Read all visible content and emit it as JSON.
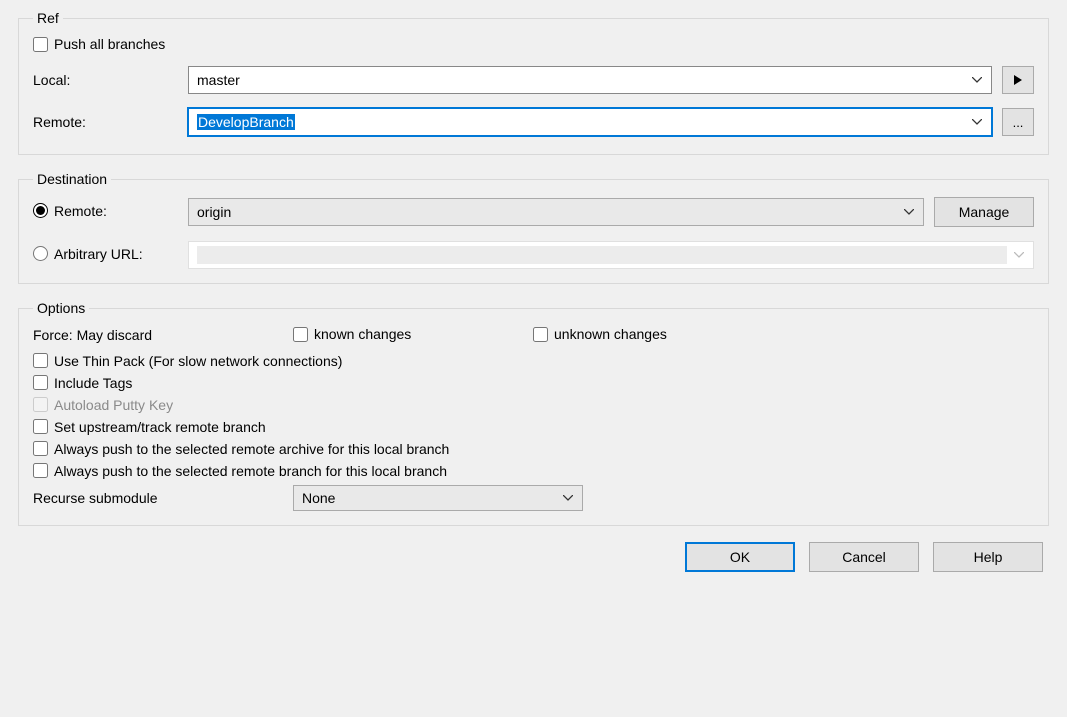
{
  "ref": {
    "legend": "Ref",
    "push_all_label": "Push all branches",
    "local_label": "Local:",
    "local_value": "master",
    "remote_label": "Remote:",
    "remote_value": "DevelopBranch",
    "browse_label": "..."
  },
  "destination": {
    "legend": "Destination",
    "remote_radio_label": "Remote:",
    "remote_value": "origin",
    "manage_label": "Manage",
    "arbitrary_radio_label": "Arbitrary URL:"
  },
  "options": {
    "legend": "Options",
    "force_label": "Force: May discard",
    "known_label": "known changes",
    "unknown_label": "unknown changes",
    "thin_pack_label": "Use Thin Pack (For slow network connections)",
    "include_tags_label": "Include Tags",
    "autoload_putty_label": "Autoload Putty Key",
    "set_upstream_label": "Set upstream/track remote branch",
    "always_archive_label": "Always push to the selected remote archive for this local branch",
    "always_branch_label": "Always push to the selected remote branch for this local branch",
    "recurse_label": "Recurse submodule",
    "recurse_value": "None"
  },
  "buttons": {
    "ok": "OK",
    "cancel": "Cancel",
    "help": "Help"
  }
}
